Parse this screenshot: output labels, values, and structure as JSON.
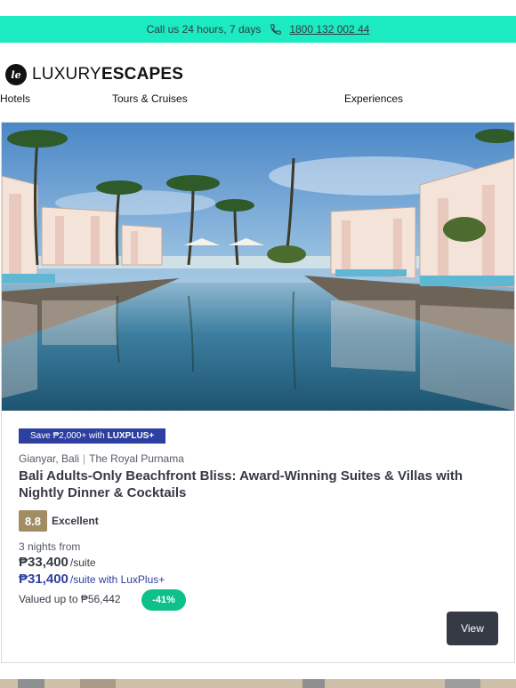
{
  "header": {
    "call_text": "Call us 24 hours, 7 days",
    "phone": "1800 132 002 44",
    "phone_icon": "phone-icon",
    "accent_color": "#1ceac0"
  },
  "brand": {
    "mark": "le",
    "name_light": "LUXURY",
    "name_bold": "ESCAPES"
  },
  "nav": {
    "items": [
      {
        "label": "Hotels"
      },
      {
        "label": "Tours & Cruises"
      },
      {
        "label": "Experiences"
      }
    ]
  },
  "offer": {
    "badge_prefix": "Save ₱2,000+ with",
    "badge_brand": "LUXPLUS+",
    "location": "Gianyar, Bali",
    "property": "The Royal Purnama",
    "title": "Bali Adults-Only Beachfront Bliss: Award-Winning Suites & Villas with Nightly Dinner & Cocktails",
    "rating_score": "8.8",
    "rating_label": "Excellent",
    "nights_text": "3 nights from",
    "price": "₱33,400",
    "price_unit": "/suite",
    "luxplus_price": "₱31,400",
    "luxplus_unit": "/suite with LuxPlus+",
    "valued_text": "Valued up to ₱56,442",
    "discount": "-41%",
    "cta": "View",
    "colors": {
      "luxplus": "#2d3fa0",
      "rating": "#a18c64",
      "discount": "#0ec18a",
      "cta": "#363a45"
    }
  }
}
